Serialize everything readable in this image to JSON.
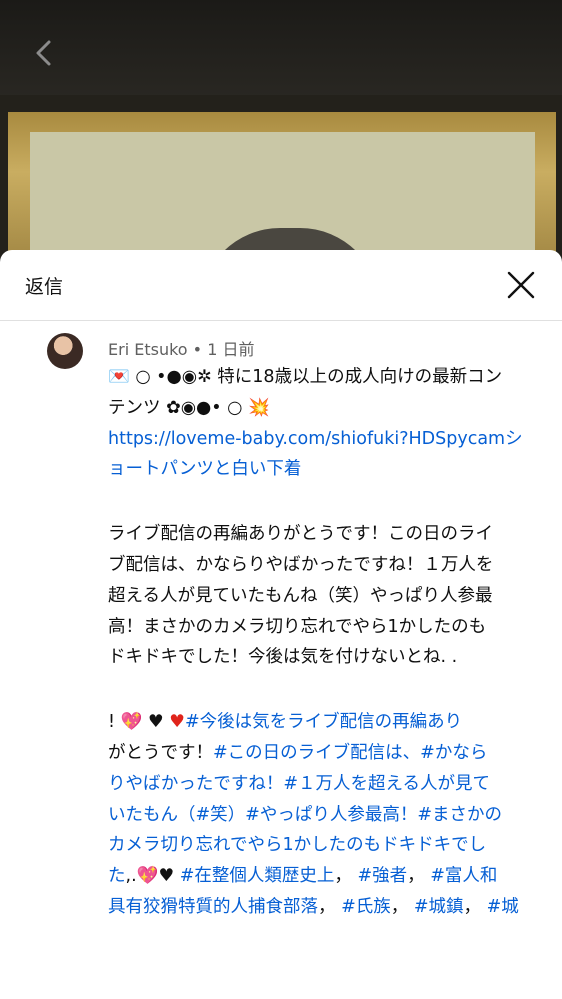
{
  "header": {
    "title": "返信"
  },
  "comment": {
    "author": "Eri Etsuko",
    "separator": "•",
    "time": "1 日前",
    "line1_symbols": "💌 ○ •●◉✲",
    "line1_text": "特に18歳以上の成人向けの最新コン",
    "line2_text": "テンツ ✿◉●• ○ 💥",
    "link_line1": "https://loveme-baby.com/shiofuki?HDSpycamシ",
    "link_line2": "ョートパンツと白い下着",
    "para2": [
      "ライブ配信の再編ありがとうです！この日のライ",
      "ブ配信は、かならりやばかったですね！１万人を",
      "超える人が見ていたもんね（笑）やっぱり人参最",
      "高！まさかのカメラ切り忘れでやら1かしたのも",
      "ドキドキでした！今後は気を付けないとね. ."
    ],
    "p3_l1_prefix": "!",
    "p3_l1_tag": "#今後は気をライブ配信の再編あり",
    "p3_l2_text": "がとうです！",
    "p3_l2_tag1": "#この日のライブ配信は、",
    "p3_l2_tag2": "#かなら",
    "p3_l3_tag1": "りやばかったですね！",
    "p3_l3_tag2": "#１万人を超える人が見て",
    "p3_l4_a": "いたもん（",
    "p3_l4_b": "#笑",
    "p3_l4_c": "）",
    "p3_l4_d": "#やっぱり人参最高",
    "p3_l4_e": "！",
    "p3_l4_f": "#まさかの",
    "p3_l5": "カメラ切り忘れでやら1かしたのもドキドキでし",
    "p3_l6_a": "た",
    "p3_l6_b": ",.",
    "p3_l6_tag1": "#在整個人類歴史上",
    "p3_l6_c": "，",
    "p3_l6_tag2": "#強者",
    "p3_l6_d": "，",
    "p3_l6_tag3": "#富人和",
    "p3_l7_tag1": "具有狡猾特質的人捕食部落",
    "p3_l7_a": "，",
    "p3_l7_tag2": "#氏族",
    "p3_l7_b": "，",
    "p3_l7_tag3": "#城鎮",
    "p3_l7_c": "，",
    "p3_l7_tag4": "#城"
  },
  "colors": {
    "link": "#065fd4",
    "text": "#0f0f0f",
    "meta": "#606060"
  },
  "icons": [
    "back-arrow-icon",
    "close-icon",
    "avatar"
  ]
}
